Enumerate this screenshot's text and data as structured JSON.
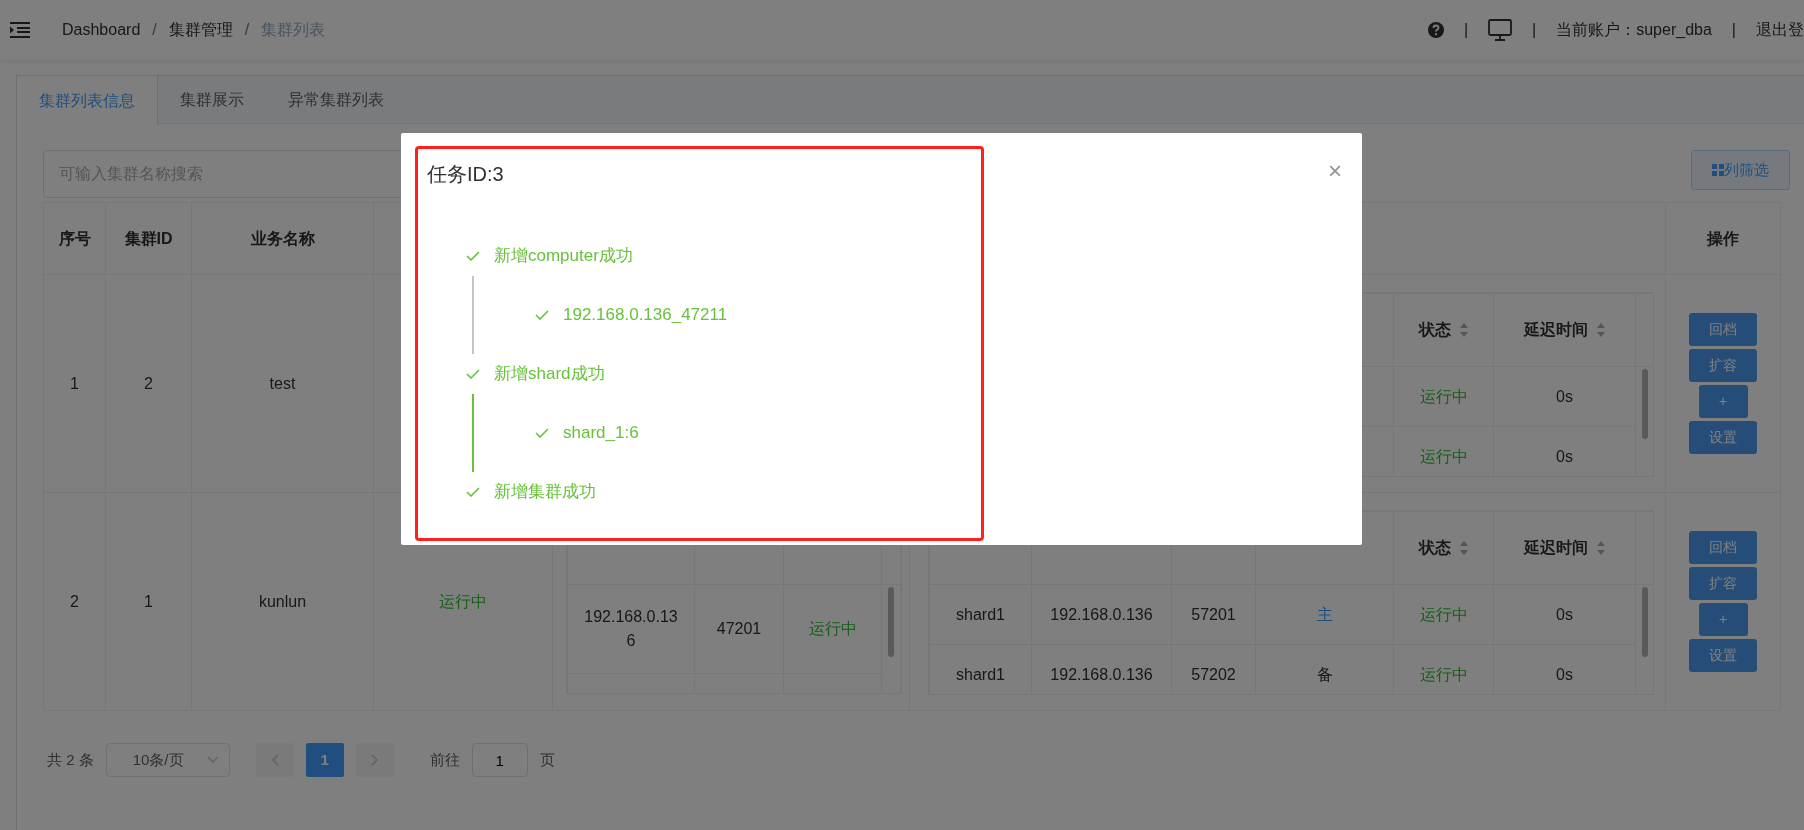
{
  "topbar": {
    "breadcrumb": [
      {
        "label": "Dashboard",
        "kind": "link"
      },
      {
        "label": "集群管理",
        "kind": "link"
      },
      {
        "label": "集群列表",
        "kind": "current"
      }
    ],
    "separators": [
      "/",
      "/"
    ],
    "dividers": [
      "|",
      "|",
      "|"
    ],
    "account": "当前账户：super_dba",
    "logout": "退出登"
  },
  "tabs": [
    {
      "label": "集群列表信息",
      "selected": true
    },
    {
      "label": "集群展示",
      "selected": false
    },
    {
      "label": "异常集群列表",
      "selected": false
    }
  ],
  "search": {
    "placeholder": "可输入集群名称搜索"
  },
  "column_filter_button": "列筛选",
  "table": {
    "columns": [
      {
        "label": "序号"
      },
      {
        "label": "集群ID"
      },
      {
        "label": "业务名称"
      },
      {
        "label": "操作"
      }
    ],
    "rows": [
      {
        "index": "1",
        "cluster_id": "2",
        "name": "test",
        "shard_table": {
          "headers": {
            "status": "状态",
            "delay": "延迟时间"
          },
          "rows": [
            {
              "status": "运行中",
              "delay": "0s"
            },
            {
              "status": "运行中",
              "delay": "0s"
            }
          ]
        },
        "actions": [
          "回档",
          "扩容",
          "+",
          "设置"
        ]
      },
      {
        "index": "2",
        "cluster_id": "1",
        "name": "kunlun",
        "status": "运行中",
        "computer_table": {
          "rows": [
            {
              "ip": "192.168.0.136",
              "port": "47201",
              "status": "运行中"
            }
          ]
        },
        "shard_table": {
          "headers": {
            "status": "状态",
            "delay": "延迟时间"
          },
          "rows": [
            {
              "name": "shard1",
              "ip": "192.168.0.136",
              "port": "57201",
              "role": "主",
              "primary": true,
              "status": "运行中",
              "delay": "0s"
            },
            {
              "name": "shard1",
              "ip": "192.168.0.136",
              "port": "57202",
              "role": "备",
              "primary": false,
              "status": "运行中",
              "delay": "0s"
            }
          ]
        },
        "actions": [
          "回档",
          "扩容",
          "+",
          "设置"
        ]
      }
    ]
  },
  "pagination": {
    "total": "共 2 条",
    "page_size": "10条/页",
    "pages": [
      {
        "label": "1",
        "selected": true
      }
    ],
    "goto_label": "前往",
    "goto_value": "1",
    "goto_suffix": "页"
  },
  "modal": {
    "title": "任务ID:3",
    "close": "×",
    "steps": [
      {
        "text": "新增computer成功",
        "done": true,
        "color": "#c0c4cc",
        "children": [
          {
            "text": "192.168.0.136_47211",
            "done": true
          }
        ]
      },
      {
        "text": "新增shard成功",
        "done": true,
        "color": "#67c23a",
        "children": [
          {
            "text": "shard_1:6",
            "done": true
          }
        ]
      },
      {
        "text": "新增集群成功",
        "done": true
      }
    ]
  }
}
